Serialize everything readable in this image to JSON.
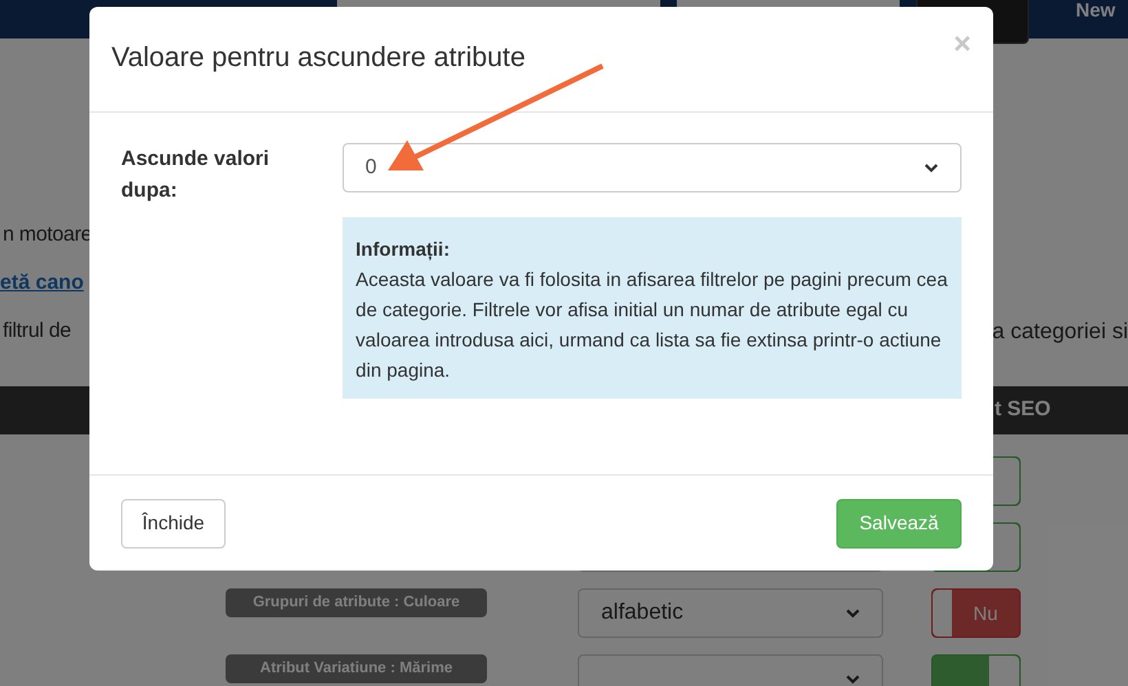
{
  "navbar": {
    "link": "New"
  },
  "page": {
    "lines": [
      {
        "left": "n motoare",
        "kind": "text"
      },
      {
        "left": "etă cano",
        "kind": "link"
      },
      {
        "left": "filtrul de",
        "right": "a categoriei si",
        "kind": "text"
      }
    ],
    "table": {
      "header": "t SEO",
      "rows": [
        {
          "label": "",
          "toggle_on": true,
          "toggle_text": ""
        },
        {
          "label": "",
          "select": "",
          "toggle_on": true,
          "toggle_text": ""
        },
        {
          "label": "Grupuri de atribute : Culoare",
          "select": "alfabetic",
          "toggle_on": false,
          "toggle_text": "Nu"
        },
        {
          "label": "Atribut Variatiune : Mărime",
          "select": "",
          "toggle_on": true,
          "toggle_text": ""
        }
      ]
    }
  },
  "modal": {
    "title": "Valoare pentru ascundere atribute",
    "close": "×",
    "field_label": "Ascunde valori dupa:",
    "select_value": "0",
    "info_title": "Informații:",
    "info_text": "Aceasta valoare va fi folosita in afisarea filtrelor pe pagini precum cea de categorie. Filtrele vor afisa initial un numar de atribute egal cu valoarea introdusa aici, urmand ca lista sa fie extinsa printr-o actiune din pagina.",
    "buttons": [
      {
        "label": "Închide",
        "kind": "default"
      },
      {
        "label": "Salvează",
        "kind": "primary"
      }
    ]
  }
}
